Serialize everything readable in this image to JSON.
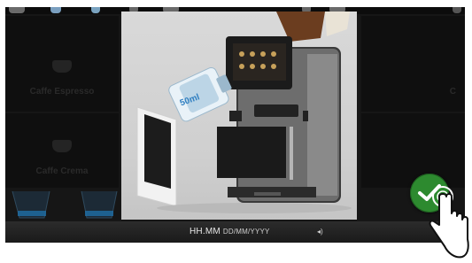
{
  "menu": {
    "left_items": [
      {
        "label": "Caffe Espresso"
      },
      {
        "label": "Caffe Crema"
      }
    ],
    "right_items": [
      {
        "label": "C"
      },
      {
        "label": ""
      }
    ]
  },
  "popup": {
    "badge": "50ml"
  },
  "status_bar": {
    "time": "HH.MM",
    "date": "DD/MM/YYYY",
    "volume_icon": "speaker-icon"
  },
  "confirm": {
    "icon": "check-icon",
    "color": "#2d8a2f"
  },
  "colors": {
    "background": "#161616",
    "popup": "#d5d5d5"
  }
}
